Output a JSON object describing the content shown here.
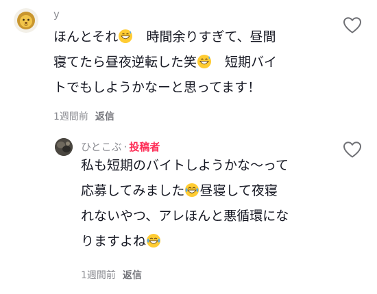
{
  "comments": [
    {
      "username": "y",
      "lines": [
        [
          "ほんとそれ",
          "",
          "　時間余りすぎて、昼間"
        ],
        [
          "寝てたら昼夜逆転した笑",
          "",
          "　短期バイ"
        ],
        [
          "トでもしようかなーと思ってます！"
        ]
      ],
      "time": "1週間前",
      "reply_label": "返信",
      "avatar_icon": "lion-face-icon",
      "like_icon": "heart-outline-icon"
    },
    {
      "username": "ひとこぶ",
      "separator": "·",
      "author_label": "投稿者",
      "lines": [
        [
          "私も短期のバイトしようかな〜って"
        ],
        [
          "応募してみました",
          "",
          "昼寝して夜寝"
        ],
        [
          "れないやつ、アレほんと悪循環にな"
        ],
        [
          "りますよね",
          ""
        ]
      ],
      "time": "1週間前",
      "reply_label": "返信",
      "avatar_icon": "profile-photo-icon",
      "like_icon": "heart-outline-icon"
    }
  ],
  "emoji": [
    "grinning-sweat-emoji",
    "tears-of-joy-emoji"
  ],
  "colors": {
    "author_tag": "#fe2c55",
    "meta": "#8a8b91",
    "text": "#161823"
  }
}
